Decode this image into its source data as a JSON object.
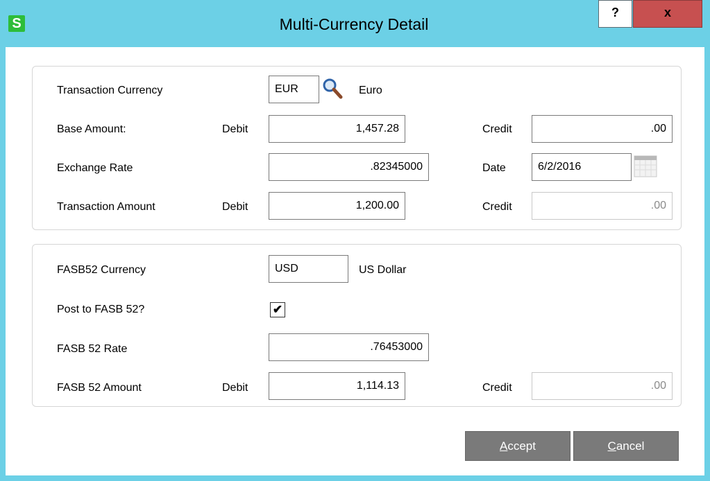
{
  "window": {
    "title": "Multi-Currency Detail",
    "app_icon_letter": "S",
    "help_label": "?",
    "close_label": "x"
  },
  "transaction": {
    "currency_label": "Transaction Currency",
    "currency_code": "EUR",
    "currency_name": "Euro",
    "base_amount_label": "Base Amount:",
    "debit_label": "Debit",
    "credit_label": "Credit",
    "base_debit": "1,457.28",
    "base_credit": ".00",
    "exchange_rate_label": "Exchange Rate",
    "exchange_rate": ".82345000",
    "date_label": "Date",
    "date": "6/2/2016",
    "transaction_amount_label": "Transaction Amount",
    "transaction_debit": "1,200.00",
    "transaction_credit": ".00"
  },
  "fasb": {
    "currency_label": "FASB52 Currency",
    "currency_code": "USD",
    "currency_name": "US Dollar",
    "post_label": "Post to FASB 52?",
    "post_checked": true,
    "check_mark": "✔",
    "rate_label": "FASB 52 Rate",
    "rate": ".76453000",
    "amount_label": "FASB 52 Amount",
    "debit_label": "Debit",
    "credit_label": "Credit",
    "amount_debit": "1,114.13",
    "amount_credit": ".00"
  },
  "buttons": {
    "accept_mnemonic": "A",
    "accept_rest": "ccept",
    "cancel_mnemonic": "C",
    "cancel_rest": "ancel"
  },
  "colors": {
    "frame": "#6cd0e6",
    "close_button": "#c75050",
    "app_icon": "#2dbd3a",
    "action_button": "#7a7a7a"
  }
}
